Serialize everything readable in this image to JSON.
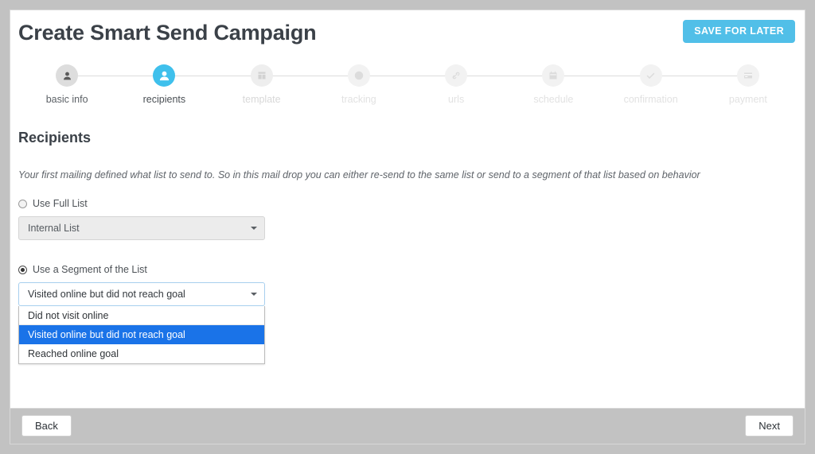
{
  "header": {
    "title": "Create Smart Send Campaign",
    "save_label": "SAVE FOR LATER",
    "accent_color": "#51bfe8"
  },
  "stepper": {
    "active_index": 1,
    "steps": [
      {
        "label": "basic info",
        "icon": "person-icon",
        "state": "done"
      },
      {
        "label": "recipients",
        "icon": "people-icon",
        "state": "active"
      },
      {
        "label": "template",
        "icon": "template-icon",
        "state": "upcoming"
      },
      {
        "label": "tracking",
        "icon": "target-icon",
        "state": "upcoming"
      },
      {
        "label": "urls",
        "icon": "link-icon",
        "state": "upcoming"
      },
      {
        "label": "schedule",
        "icon": "calendar-icon",
        "state": "upcoming"
      },
      {
        "label": "confirmation",
        "icon": "check-icon",
        "state": "upcoming"
      },
      {
        "label": "payment",
        "icon": "credit-card-icon",
        "state": "upcoming"
      }
    ]
  },
  "main": {
    "section_title": "Recipients",
    "description": "Your first mailing defined what list to send to. So in this mail drop you can either re-send to the same list or send to a segment of that list based on behavior",
    "full_list": {
      "radio_label": "Use Full List",
      "radio_checked": false,
      "select_value": "Internal List",
      "select_disabled": true
    },
    "segment": {
      "radio_label": "Use a Segment of the List",
      "radio_checked": true,
      "select_value": "Visited online but did not reach goal",
      "select_open": true,
      "options": [
        {
          "label": "Did not visit online",
          "selected": false
        },
        {
          "label": "Visited online but did not reach goal",
          "selected": true
        },
        {
          "label": "Reached online goal",
          "selected": false
        }
      ],
      "highlight_color": "#1a73e8"
    }
  },
  "footer": {
    "back_label": "Back",
    "next_label": "Next"
  }
}
